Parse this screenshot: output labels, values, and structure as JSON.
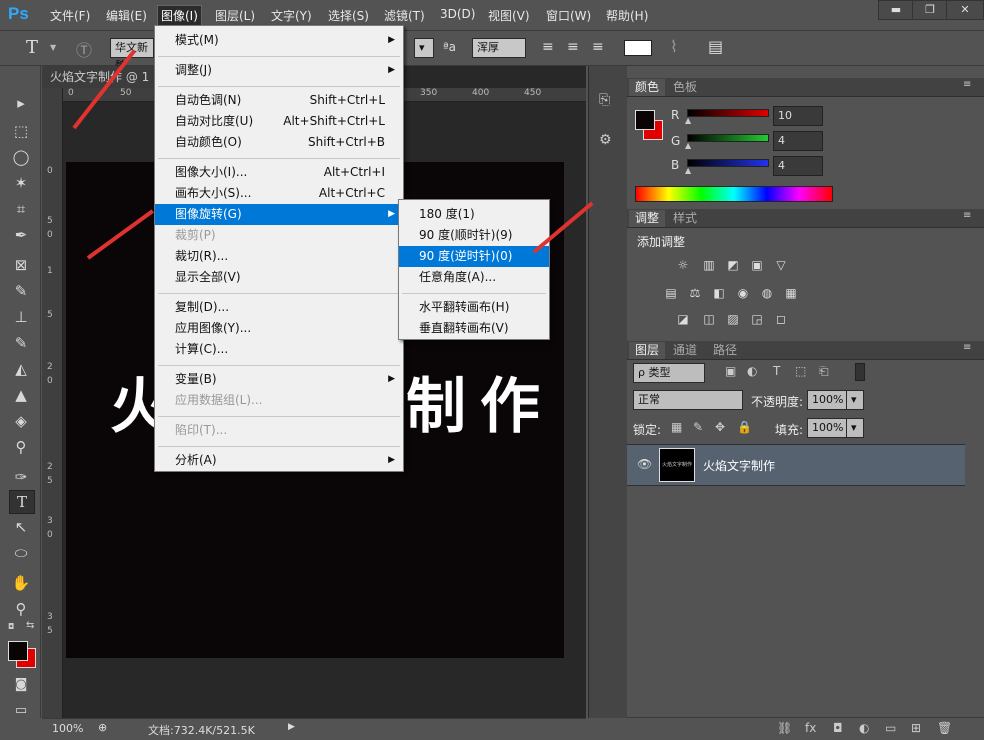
{
  "menubar": {
    "logo": "Ps",
    "items": [
      "文件(F)",
      "编辑(E)",
      "图像(I)",
      "图层(L)",
      "文字(Y)",
      "选择(S)",
      "滤镜(T)",
      "3D(D)",
      "视图(V)",
      "窗口(W)",
      "帮助(H)"
    ],
    "active": "图像(I)",
    "window_buttons": [
      "▬",
      "❐",
      "✕"
    ]
  },
  "options": {
    "tool_icon": "T",
    "font_name": "华文新魏",
    "aa_label": "ªa",
    "aa_value": "浑厚"
  },
  "document": {
    "tab_title": "火焰文字制作 @ 1",
    "ruler_top": [
      "0",
      "50",
      "350",
      "400",
      "450"
    ],
    "ruler_left": [
      "0",
      "5",
      "0",
      "1",
      "5",
      "2",
      "0",
      "2",
      "5",
      "3",
      "0",
      "3",
      "5"
    ],
    "canvas_text": "火焰文字制作",
    "zoom": "100%",
    "doc_size": "文档:732.4K/521.5K"
  },
  "image_menu": {
    "items": [
      {
        "label": "模式(M)",
        "submenu": true
      },
      {
        "sep": true
      },
      {
        "label": "调整(J)",
        "submenu": true
      },
      {
        "sep": true
      },
      {
        "label": "自动色调(N)",
        "shortcut": "Shift+Ctrl+L"
      },
      {
        "label": "自动对比度(U)",
        "shortcut": "Alt+Shift+Ctrl+L"
      },
      {
        "label": "自动颜色(O)",
        "shortcut": "Shift+Ctrl+B"
      },
      {
        "sep": true
      },
      {
        "label": "图像大小(I)...",
        "shortcut": "Alt+Ctrl+I"
      },
      {
        "label": "画布大小(S)...",
        "shortcut": "Alt+Ctrl+C"
      },
      {
        "label": "图像旋转(G)",
        "submenu": true,
        "highlight": true
      },
      {
        "label": "裁剪(P)",
        "disabled": true
      },
      {
        "label": "裁切(R)..."
      },
      {
        "label": "显示全部(V)"
      },
      {
        "sep": true
      },
      {
        "label": "复制(D)..."
      },
      {
        "label": "应用图像(Y)..."
      },
      {
        "label": "计算(C)..."
      },
      {
        "sep": true
      },
      {
        "label": "变量(B)",
        "submenu": true
      },
      {
        "label": "应用数据组(L)...",
        "disabled": true
      },
      {
        "sep": true
      },
      {
        "label": "陷印(T)...",
        "disabled": true
      },
      {
        "sep": true
      },
      {
        "label": "分析(A)",
        "submenu": true
      }
    ]
  },
  "rotate_submenu": {
    "items": [
      {
        "label": "180 度(1)"
      },
      {
        "label": "90 度(顺时针)(9)"
      },
      {
        "label": "90 度(逆时针)(0)",
        "highlight": true
      },
      {
        "label": "任意角度(A)..."
      },
      {
        "sep": true
      },
      {
        "label": "水平翻转画布(H)"
      },
      {
        "label": "垂直翻转画布(V)"
      }
    ]
  },
  "color_panel": {
    "tabs": [
      "颜色",
      "色板"
    ],
    "r_label": "R",
    "g_label": "G",
    "b_label": "B",
    "r": "10",
    "g": "4",
    "b": "4",
    "colors": {
      "r": "#cc2222",
      "g": "#22aa33",
      "b": "#2233cc",
      "fg": "#0a0404",
      "bg": "#e00000"
    }
  },
  "adjust_panel": {
    "tabs": [
      "调整",
      "样式"
    ],
    "title": "添加调整",
    "row1": [
      "☼",
      "▥",
      "◩",
      "▣",
      "▽"
    ],
    "row2": [
      "▤",
      "⚖",
      "◧",
      "◉",
      "◍",
      "▦"
    ],
    "row3": [
      "◪",
      "◫",
      "▨",
      "◲",
      "◻"
    ]
  },
  "layers_panel": {
    "tabs": [
      "图层",
      "通道",
      "路径"
    ],
    "filter_label": "ρ 类型",
    "blend_mode": "正常",
    "opacity_label": "不透明度:",
    "opacity": "100%",
    "lock_label": "锁定:",
    "fill_label": "填充:",
    "fill": "100%",
    "layer_name": "火焰文字制作",
    "thumb_text": "火焰文字制作",
    "bottom_icons": [
      "⛓",
      "fx",
      "◘",
      "◐",
      "▭",
      "⊞",
      "🗑"
    ]
  },
  "toolbox": {
    "tools": [
      "▸",
      "⬚",
      "◯",
      "✶",
      "⌗",
      "✒",
      "⊠",
      "✎",
      "⊥",
      "✎",
      "◭",
      "▲",
      "◈",
      "⚲",
      "✑",
      "T",
      "↖",
      "⬭",
      "✋",
      "⚲"
    ]
  }
}
